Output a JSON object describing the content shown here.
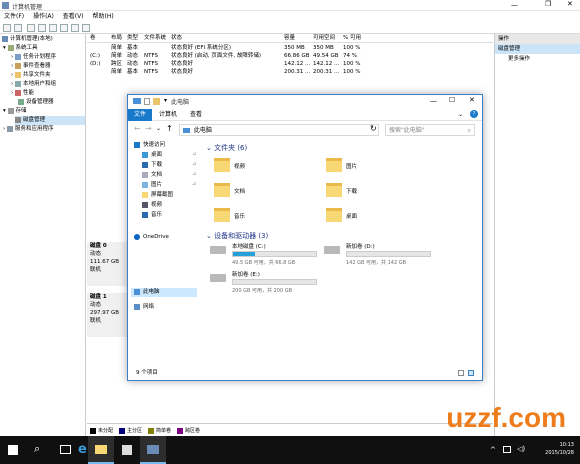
{
  "cm": {
    "title": "计算机管理",
    "menu": [
      "文件(F)",
      "操作(A)",
      "查看(V)",
      "帮助(H)"
    ],
    "tree": [
      {
        "label": "计算机管理(本地)",
        "indent": 0
      },
      {
        "label": "系统工具",
        "indent": 1
      },
      {
        "label": "任务计划程序",
        "indent": 2
      },
      {
        "label": "事件查看器",
        "indent": 2
      },
      {
        "label": "共享文件夹",
        "indent": 2
      },
      {
        "label": "本地用户和组",
        "indent": 2
      },
      {
        "label": "性能",
        "indent": 2
      },
      {
        "label": "设备管理器",
        "indent": 2
      },
      {
        "label": "存储",
        "indent": 1
      },
      {
        "label": "磁盘管理",
        "indent": 2
      },
      {
        "label": "服务和应用程序",
        "indent": 1
      }
    ],
    "vol_headers": [
      "卷",
      "布局",
      "类型",
      "文件系统",
      "状态",
      "容量",
      "可用空间",
      "% 可用"
    ],
    "vol_rows": [
      [
        "",
        "简单",
        "基本",
        "",
        "状态良好 (EFI 系统分区)",
        "350 MB",
        "350 MB",
        "100 %"
      ],
      [
        "(C:)",
        "简单",
        "动态",
        "NTFS",
        "状态良好 (启动, 页面文件, 故障转储)",
        "66.86 GB",
        "49.54 GB",
        "74 %"
      ],
      [
        "(D:)",
        "跨区",
        "动态",
        "NTFS",
        "状态良好",
        "142.12 ...",
        "142.12 ...",
        "100 %"
      ],
      [
        "",
        "简单",
        "基本",
        "NTFS",
        "状态良好",
        "200.31 ...",
        "200.31 ...",
        "100 %"
      ]
    ],
    "disks": [
      {
        "name": "磁盘 0",
        "type": "动态",
        "size": "111.67 GB",
        "status": "联机"
      },
      {
        "name": "磁盘 1",
        "type": "动态",
        "size": "297.97 GB",
        "status": "联机"
      }
    ],
    "legend": [
      {
        "label": "未分配",
        "color": "#000000"
      },
      {
        "label": "主分区",
        "color": "#00007f"
      },
      {
        "label": "简单卷",
        "color": "#7f7f00"
      },
      {
        "label": "跨区卷",
        "color": "#7f007f"
      }
    ],
    "actions": {
      "header": "操作",
      "selected": "磁盘管理",
      "more": "更多操作"
    }
  },
  "exp": {
    "title": "此电脑",
    "tabs": [
      "文件",
      "计算机",
      "查看"
    ],
    "address": "此电脑",
    "search_placeholder": "搜索\"此电脑\"",
    "nav": [
      {
        "label": "快速访问",
        "icon": "star-icon"
      },
      {
        "label": "桌面",
        "icon": "desktop-icon"
      },
      {
        "label": "下载",
        "icon": "download-icon"
      },
      {
        "label": "文档",
        "icon": "document-icon"
      },
      {
        "label": "图片",
        "icon": "picture-icon"
      },
      {
        "label": "屏幕截图",
        "icon": "folder-icon"
      },
      {
        "label": "视频",
        "icon": "video-icon"
      },
      {
        "label": "音乐",
        "icon": "music-icon"
      },
      {
        "label": "OneDrive",
        "icon": "cloud-icon"
      },
      {
        "label": "此电脑",
        "icon": "pc-icon"
      },
      {
        "label": "网络",
        "icon": "network-icon"
      }
    ],
    "folders_header": "文件夹 (6)",
    "folders": [
      "视频",
      "图片",
      "文档",
      "下载",
      "音乐",
      "桌面"
    ],
    "drives_header": "设备和驱动器 (3)",
    "drives": [
      {
        "name": "本地磁盘 (C:)",
        "space": "49.5 GB 可用，共 66.8 GB",
        "used": 0.26
      },
      {
        "name": "新加卷 (D:)",
        "space": "142 GB 可用，共 142 GB",
        "used": 0.0
      },
      {
        "name": "新加卷 (E:)",
        "space": "200 GB 可用，共 200 GB",
        "used": 0.0
      }
    ],
    "status": "9 个项目"
  },
  "taskbar": {
    "time": "10:13",
    "date": "2015/10/28"
  },
  "watermark": "uzzf.com"
}
